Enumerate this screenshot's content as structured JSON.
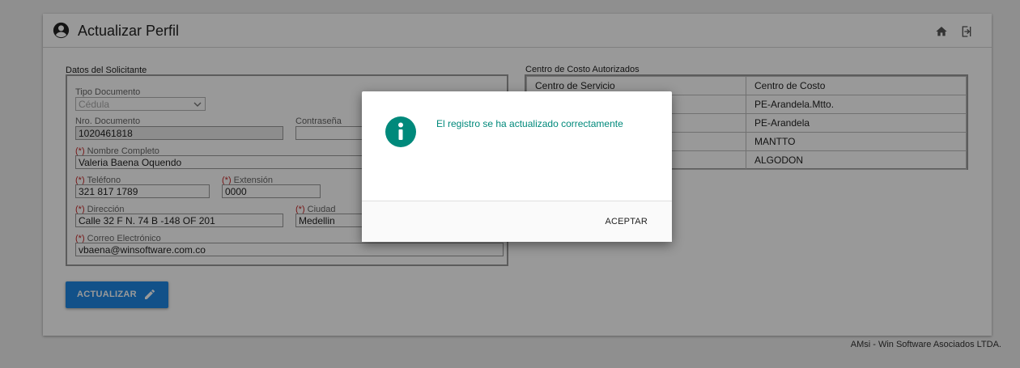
{
  "header": {
    "title": "Actualizar Perfil",
    "icons": {
      "user": "account-circle-icon",
      "home": "home-icon",
      "exit": "logout-icon"
    }
  },
  "solicitante": {
    "section_title": "Datos del Solicitante",
    "tipo_documento": {
      "label": "Tipo Documento",
      "value": "Cédula"
    },
    "nro_documento": {
      "label": "Nro. Documento",
      "value": "1020461818"
    },
    "contrasena": {
      "label": "Contraseña",
      "value": ""
    },
    "nombre": {
      "req": "(*)",
      "label": "Nombre Completo",
      "value": "Valeria Baena Oquendo"
    },
    "telefono": {
      "req": "(*)",
      "label": "Teléfono",
      "value": "321 817 1789"
    },
    "extension": {
      "req": "(*)",
      "label": "Extensión",
      "value": "0000"
    },
    "direccion": {
      "req": "(*)",
      "label": "Dirección",
      "value": "Calle 32 F N. 74 B -148 OF 201"
    },
    "ciudad": {
      "req": "(*)",
      "label": "Ciudad",
      "value": "Medellin"
    },
    "correo": {
      "req": "(*)",
      "label": "Correo Electrónico",
      "value": "vbaena@winsoftware.com.co"
    }
  },
  "centro_costo": {
    "section_title": "Centro de Costo Autorizados",
    "columns": [
      "Centro de Servicio",
      "Centro de Costo"
    ],
    "rows": [
      [
        "",
        "PE-Arandela.Mtto."
      ],
      [
        "",
        "PE-Arandela"
      ],
      [
        "",
        "MANTTO"
      ],
      [
        "",
        "ALGODON"
      ]
    ]
  },
  "actions": {
    "update_label": "ACTUALIZAR",
    "update_icon": "pencil-icon"
  },
  "footer": {
    "text": "AMsi - Win Software Asociados LTDA."
  },
  "dialog": {
    "icon": "info-icon",
    "message": "El registro se ha actualizado correctamente",
    "accept_label": "ACEPTAR"
  },
  "colors": {
    "primary_button": "#1e88e5",
    "dialog_icon": "#00897b",
    "required_marker": "#c62828"
  }
}
